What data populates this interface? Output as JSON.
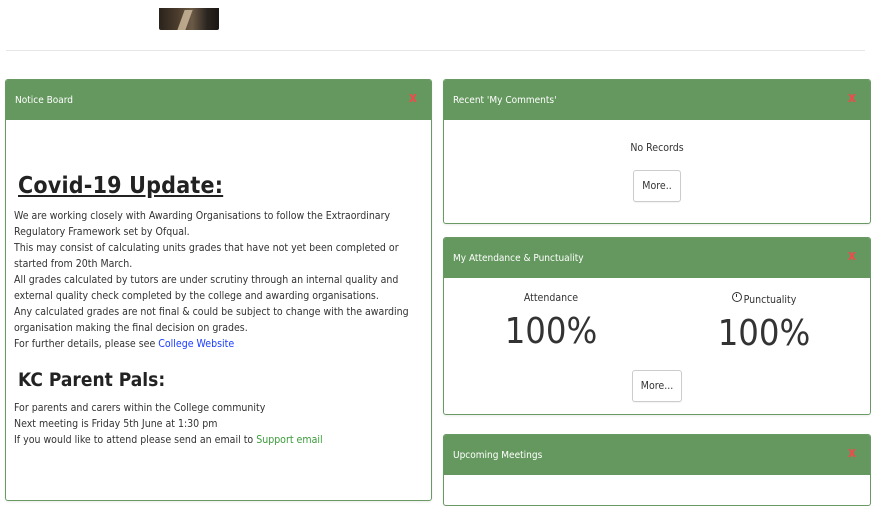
{
  "colors": {
    "header_green": "#64985e",
    "close_red": "#ef4b4b",
    "link_blue": "#1a3cff"
  },
  "notice": {
    "title": "Notice Board",
    "close": "x",
    "covid_heading": "Covid-19 Update:",
    "covid_paragraphs": [
      "We are working closely with Awarding Organisations to follow the Extraordinary Regulatory Framework set by Ofqual.",
      "This may consist of calculating units grades that have not yet been completed or started from 20th March.",
      "All grades calculated by tutors are under scrutiny through an internal quality and external quality check completed by the college and awarding organisations.",
      "Any calculated grades are not final & could be subject to change with the awarding organisation making the final decision on grades."
    ],
    "further_prefix": "For further details, please see ",
    "college_link": "College Website",
    "pals_heading": "KC Parent Pals:",
    "pals_lines": [
      "For parents and carers within the College community",
      "Next meeting is Friday 5th June at 1:30 pm"
    ],
    "pals_partial_prefix": "If you would like to attend please send an email to ",
    "pals_partial_link": "Support email"
  },
  "comments": {
    "title": "Recent 'My Comments'",
    "close": "x",
    "empty_text": "No Records",
    "more_button": "More.."
  },
  "attendance": {
    "title": "My Attendance & Punctuality",
    "close": "x",
    "attendance_label": "Attendance",
    "attendance_value": "100%",
    "punctuality_label": "Punctuality",
    "punctuality_value": "100%",
    "more_button": "More..."
  },
  "meetings": {
    "title": "Upcoming Meetings",
    "close": "x"
  }
}
